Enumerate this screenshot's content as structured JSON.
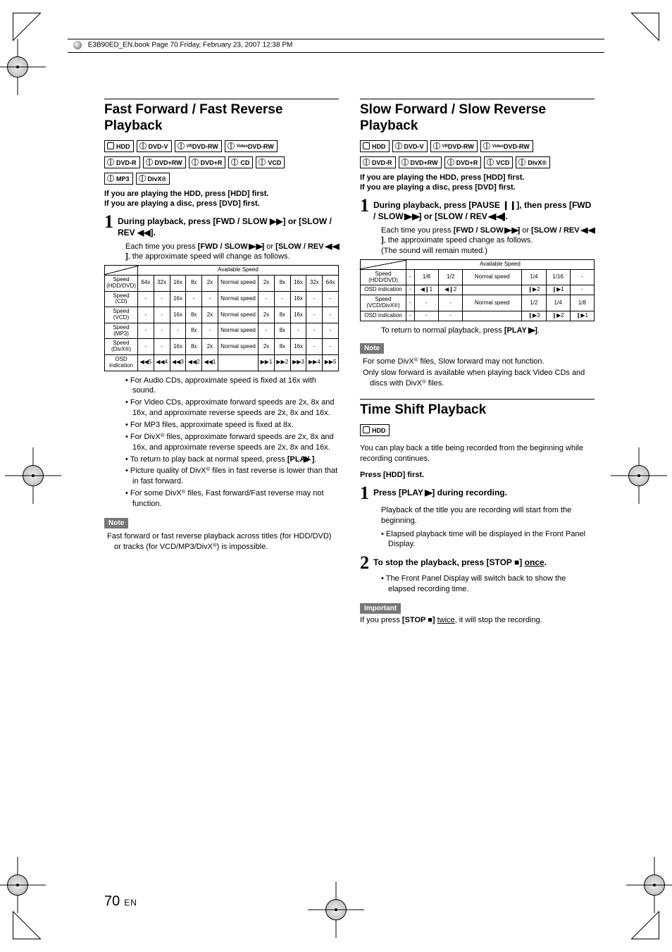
{
  "header": {
    "file_info": "E3B90ED_EN.book  Page 70  Friday, February 23, 2007  12:38 PM"
  },
  "page_number": {
    "num": "70",
    "lang": "EN"
  },
  "left": {
    "title": "Fast Forward / Fast Reverse Playback",
    "badges_row1": [
      "HDD",
      "DVD-V",
      "DVD-RW",
      "DVD-RW"
    ],
    "badges_row1_sup": [
      "",
      "",
      "VR",
      "Video"
    ],
    "badges_row2": [
      "DVD-R",
      "DVD+RW",
      "DVD+R",
      "CD",
      "VCD"
    ],
    "badges_row3": [
      "MP3",
      "DivX®"
    ],
    "intro": "If you are playing the HDD, press [HDD] first.\nIf you are playing a disc, press [DVD] first.",
    "step1_num": "1",
    "step1_text": "During playback, press [FWD / SLOW ▶▶] or [SLOW / REV ◀◀].",
    "step1_sub": "Each time you press [FWD / SLOW ▶▶] or [SLOW / REV ◀◀], the approximate speed will change as follows.",
    "table": {
      "header": "Available Speed",
      "rows": [
        {
          "label": "Speed (HDD/DVD)",
          "cells": [
            "64x",
            "32x",
            "16x",
            "8x",
            "2x",
            "Normal speed",
            "2x",
            "8x",
            "16x",
            "32x",
            "64x"
          ]
        },
        {
          "label": "Speed (CD)",
          "cells": [
            "-",
            "-",
            "16x",
            "-",
            "-",
            "Normal speed",
            "-",
            "-",
            "16x",
            "-",
            "-"
          ]
        },
        {
          "label": "Speed (VCD)",
          "cells": [
            "-",
            "-",
            "16x",
            "8x",
            "2x",
            "Normal speed",
            "2x",
            "8x",
            "16x",
            "-",
            "-"
          ]
        },
        {
          "label": "Speed (MP3)",
          "cells": [
            "-",
            "-",
            "-",
            "8x",
            "-",
            "Normal speed",
            "-",
            "8x",
            "-",
            "-",
            "-"
          ]
        },
        {
          "label": "Speed (DivX®)",
          "cells": [
            "-",
            "-",
            "16x",
            "8x",
            "2x",
            "Normal speed",
            "2x",
            "8x",
            "16x",
            "-",
            "-"
          ]
        },
        {
          "label": "OSD indication",
          "cells": [
            "◀◀5",
            "◀◀4",
            "◀◀3",
            "◀◀2",
            "◀◀1",
            "",
            "▶▶1",
            "▶▶2",
            "▶▶3",
            "▶▶4",
            "▶▶5"
          ]
        }
      ]
    },
    "bullets": [
      "For Audio CDs, approximate speed is fixed at 16x with sound.",
      "For Video CDs, approximate forward speeds are 2x, 8x and 16x, and approximate reverse speeds are 2x, 8x and 16x.",
      "For MP3 files, approximate speed is fixed at 8x.",
      "For DivX® files, approximate forward speeds are 2x, 8x and 16x, and approximate reverse speeds are 2x, 8x and 16x.",
      "To return to play back at normal speed, press [PLAY ▶].",
      "Picture quality of DivX® files in fast reverse is lower than that in fast forward.",
      "For some DivX® files, Fast forward/Fast reverse may not function."
    ],
    "note_tag": "Note",
    "note_body": "Fast forward or fast reverse playback across titles (for HDD/DVD) or tracks (for VCD/MP3/DivX®) is impossible."
  },
  "right": {
    "slow": {
      "title": "Slow Forward / Slow Reverse Playback",
      "badges_row1": [
        "HDD",
        "DVD-V",
        "DVD-RW",
        "DVD-RW"
      ],
      "badges_row1_sup": [
        "",
        "",
        "VR",
        "Video"
      ],
      "badges_row2": [
        "DVD-R",
        "DVD+RW",
        "DVD+R",
        "VCD",
        "DivX®"
      ],
      "intro": "If you are playing the HDD, press [HDD] first.\nIf you are playing a disc, press [DVD] first.",
      "step1_num": "1",
      "step1_text": "During playback, press [PAUSE ❙❙], then press [FWD / SLOW ▶▶] or [SLOW / REV ◀◀].",
      "step1_sub": "Each time you press [FWD / SLOW ▶▶] or [SLOW / REV ◀◀], the approximate speed change as follows.\n(The sound will remain muted.)",
      "table": {
        "header": "Available Speed",
        "rows": [
          {
            "label": "Speed (HDD/DVD)",
            "cells": [
              "-",
              "1/8",
              "1/2",
              "Normal speed",
              "1/4",
              "1/16",
              "-"
            ]
          },
          {
            "label": "OSD indication",
            "cells": [
              "-",
              "◀❙1",
              "◀❙2",
              "",
              "❙▶2",
              "❙▶1",
              "-"
            ]
          },
          {
            "label": "Speed (VCD/DivX®)",
            "cells": [
              "-",
              "-",
              "-",
              "Normal speed",
              "1/2",
              "1/4",
              "1/8"
            ]
          },
          {
            "label": "OSD indication",
            "cells": [
              "-",
              "-",
              "-",
              "",
              "❙▶3",
              "❙▶2",
              "❙▶1"
            ]
          }
        ]
      },
      "return_text": "To return to normal playback, press [PLAY ▶].",
      "note_tag": "Note",
      "notes": [
        "For some DivX® files, Slow forward may not function.",
        "Only slow forward is available when playing back Video CDs and discs with DivX® files."
      ]
    },
    "timeshift": {
      "title": "Time Shift Playback",
      "badge": "HDD",
      "intro": "You can play back a title being recorded from the beginning while recording continues.",
      "press_first": "Press [HDD] first.",
      "step1_num": "1",
      "step1_text": "Press [PLAY ▶] during recording.",
      "step1_sub": "Playback of the title you are recording will start from the beginning.",
      "step1_bullet": "Elapsed playback time will be displayed in the Front Panel Display.",
      "step2_num": "2",
      "step2_text_a": "To stop the playback, press [STOP ■] ",
      "step2_text_b": "once",
      "step2_text_c": ".",
      "step2_bullet": "The Front Panel Display will switch back to show the elapsed recording time.",
      "important_tag": "Important",
      "important_a": "If you press ",
      "important_b": "[STOP ■]",
      "important_c": " ",
      "important_d": "twice",
      "important_e": ", it will stop the recording."
    }
  }
}
